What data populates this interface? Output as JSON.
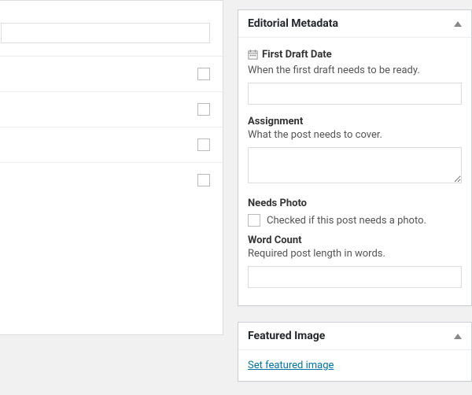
{
  "editorial_metadata": {
    "panel_title": "Editorial Metadata",
    "first_draft": {
      "label": "First Draft Date",
      "desc": "When the first draft needs to be ready.",
      "value": ""
    },
    "assignment": {
      "label": "Assignment",
      "desc": "What the post needs to cover.",
      "value": ""
    },
    "needs_photo": {
      "label": "Needs Photo",
      "desc": "Checked if this post needs a photo.",
      "checked": false
    },
    "word_count": {
      "label": "Word Count",
      "desc": "Required post length in words.",
      "value": ""
    }
  },
  "featured_image": {
    "panel_title": "Featured Image",
    "link_text": "Set featured image"
  }
}
